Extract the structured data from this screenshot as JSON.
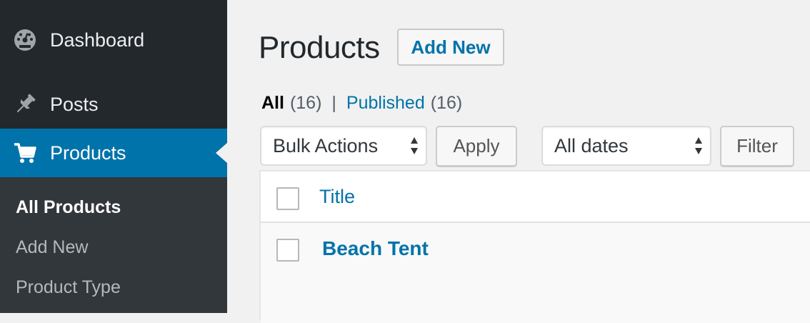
{
  "sidebar": {
    "dashboard": {
      "label": "Dashboard",
      "icon": "dashboard-icon"
    },
    "posts": {
      "label": "Posts",
      "icon": "pin-icon"
    },
    "products": {
      "label": "Products",
      "icon": "cart-icon"
    },
    "submenu": [
      {
        "label": "All Products",
        "current": true
      },
      {
        "label": "Add New"
      },
      {
        "label": "Product Type"
      }
    ]
  },
  "header": {
    "title": "Products",
    "add_new_label": "Add New"
  },
  "views": {
    "all_label": "All",
    "all_count": "(16)",
    "separator": "|",
    "published_label": "Published",
    "published_count": "(16)"
  },
  "toolbar": {
    "bulk_actions": "Bulk Actions",
    "apply_label": "Apply",
    "dates": "All dates",
    "filter_label": "Filter"
  },
  "table": {
    "columns": [
      "Title"
    ],
    "rows": [
      {
        "title": "Beach Tent"
      }
    ]
  },
  "colors": {
    "sidebar_bg": "#23282d",
    "submenu_bg": "#32373c",
    "accent": "#0073aa",
    "page_bg": "#f1f1f1"
  }
}
